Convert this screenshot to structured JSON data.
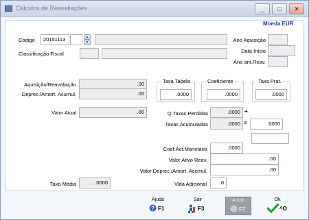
{
  "window": {
    "title": "Cálculos de Reavaliações",
    "buttons": [
      "_",
      "□",
      "✕"
    ]
  },
  "currency": "Moeda EUR",
  "form": {
    "codigo_label": "Código",
    "codigo_value": "20151113",
    "codigo_extra": "",
    "codigo_desc": "",
    "classificacao_label": "Classificação Fiscal",
    "classificacao_code": "",
    "classificacao_desc": "",
    "ano_aquisicao_label": "Ano Aquisição",
    "ano_aquisicao_value": "",
    "data_inicio_label": "Data Início",
    "data_inicio_value": "",
    "ano_ant_reav_label": "Ano ant.Reav.",
    "ano_ant_reav_value": "",
    "aquisicao_label": "Aquisição/Reavaliação",
    "aquisicao_value": ".00",
    "deprec_label": "Deprec./Amort. Acumul.",
    "deprec_value": ".00",
    "valor_atual_label": "Valor Atual",
    "valor_atual_value": ".00",
    "taxa_tabela_label": "Taxa Tabela",
    "taxa_tabela_value": ".0000",
    "coeficiente_label": "Coeficiente",
    "coeficiente_value": ".0000",
    "taxa_prat_label": "Taxa Prat.",
    "taxa_prat_value": ".0000",
    "q_taxas_perdidas_label": "Q.Taxas Perdidas",
    "q_taxas_perdidas_value": ".0000",
    "q_taxas_sign": "+",
    "taxas_acumuladas_label": "Taxas Acumuladas",
    "taxas_acumuladas_value": ".0000",
    "taxas_equal_sign": "=",
    "taxas_total_value": ".0000",
    "extra_box_value": "",
    "coef_act_label": "Coef.Act.Monetária",
    "coef_act_value": ".0000",
    "valor_ativo_label": "Valor Ativo Reav.",
    "valor_ativo_value": ".00",
    "valor_deprec_label": "Valor Deprec./Amort. Acumul.",
    "valor_deprec_value": ".00",
    "taxa_media_label": "Taxa Média",
    "taxa_media_value": ".0000",
    "vida_adicional_label": "Vida Adicional",
    "vida_adicional_value": "0"
  },
  "footer": {
    "ajuda": {
      "label": "Ajuda",
      "key": "F1"
    },
    "sair": {
      "label": "Sair",
      "key": "F3"
    },
    "anula": {
      "label": "Anula",
      "key": "F7"
    },
    "ok": {
      "label": "Ok",
      "key": "^O"
    }
  },
  "colors": {
    "accent": "#1f3f9a",
    "ok_check": "#1c9b2e"
  }
}
